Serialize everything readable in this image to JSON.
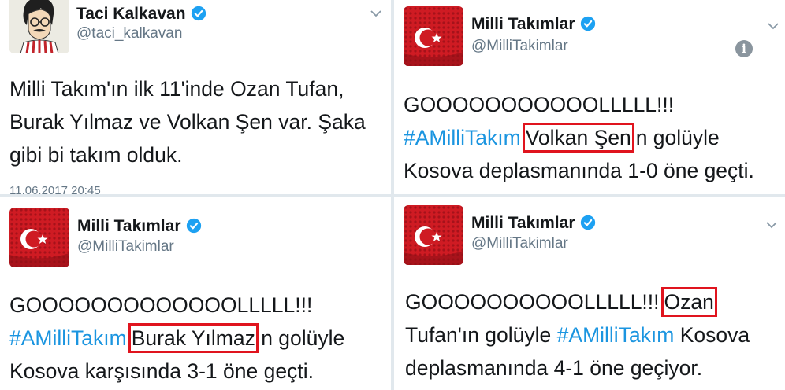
{
  "tweet1": {
    "name": "Taci Kalkavan",
    "handle": "@taci_kalkavan",
    "lines": [
      "Milli Takım'ın ilk 11'inde Ozan Tufan,",
      "Burak Yılmaz ve Volkan Şen var. Şaka",
      "gibi bi takım olduk."
    ],
    "timestamp": "11.06.2017 20:45",
    "avatar_icon": "cartoon-man-avatar"
  },
  "tweet2": {
    "name": "Milli Takımlar",
    "handle": "@MilliTakimlar",
    "line1": "GOOOOOOOOOOOLLLLL!!!",
    "hashtag": "#AMilliTakım",
    "highlight": "Volkan Şen",
    "after": "in golüyle",
    "line3": "Kosova deplasmanında 1-0 öne geçti.",
    "info_icon": "i"
  },
  "tweet3": {
    "name": "Milli Takımlar",
    "handle": "@MilliTakimlar",
    "line1": "GOOOOOOOOOOOOOLLLLL!!!",
    "hashtag": "#AMilliTakım",
    "highlight": "Burak Yılmaz",
    "after": "ın golüyle",
    "line3": "Kosova karşısında 3-1 öne geçti."
  },
  "tweet4": {
    "name": "Milli Takımlar",
    "handle": "@MilliTakimlar",
    "line1_before": "GOOOOOOOOOOLLLLL!!!",
    "highlight": "Ozan",
    "line2_before": "Tufan'ın golüyle",
    "hashtag": "#AMilliTakım",
    "line2_after": "Kosova",
    "line3": "deplasmanında 4-1 öne geçiyor."
  },
  "colors": {
    "verified": "#1da1f2",
    "hashtag": "#1b95e0",
    "highlight": "#e0141e",
    "avatar_red": "#d21c24"
  }
}
